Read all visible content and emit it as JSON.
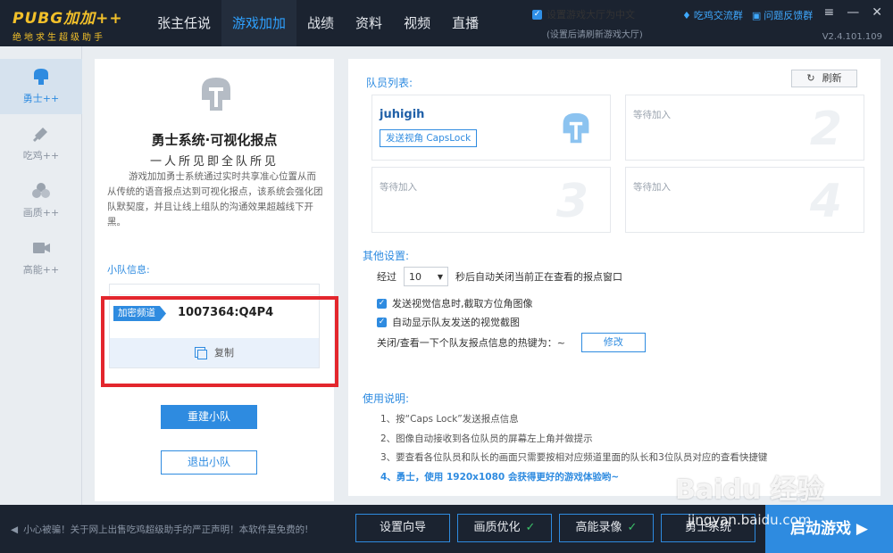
{
  "logo": {
    "title": "PUBG加加++",
    "subtitle": "绝地求生超级助手"
  },
  "nav": [
    {
      "label": "张主任说"
    },
    {
      "label": "游戏加加"
    },
    {
      "label": "战绩"
    },
    {
      "label": "资料"
    },
    {
      "label": "视频"
    },
    {
      "label": "直播"
    }
  ],
  "lang": {
    "label": "设置游戏大厅为中文",
    "hint": "(设置后请刷新游戏大厅)"
  },
  "links": {
    "group": "吃鸡交流群",
    "feedback": "问题反馈群"
  },
  "version": "V2.4.101.109",
  "sidebar": [
    {
      "label": "勇士++",
      "icon": "helmet-icon"
    },
    {
      "label": "吃鸡++",
      "icon": "chicken-icon"
    },
    {
      "label": "画质++",
      "icon": "quality-icon"
    },
    {
      "label": "高能++",
      "icon": "camera-icon"
    }
  ],
  "left": {
    "title": "勇士系统·可视化报点",
    "subtitle": "一人所见即全队所见",
    "desc": "游戏加加勇士系统通过实时共享准心位置从而从传统的语音报点达到可视化报点，该系统会强化团队默契度，并且让线上组队的沟通效果超越线下开黑。",
    "team_label": "小队信息:",
    "channel_tag": "加密频道",
    "channel_code": "1007364:Q4P4",
    "copy": "复制",
    "rebuild": "重建小队",
    "exit": "退出小队"
  },
  "right": {
    "members_label": "队员列表:",
    "refresh": "刷新",
    "members": [
      {
        "name": "juhigih",
        "send": "发送视角 CapsLock"
      },
      {
        "wait": "等待加入",
        "num": "2"
      },
      {
        "wait": "等待加入",
        "num": "3"
      },
      {
        "wait": "等待加入",
        "num": "4"
      }
    ],
    "other_label": "其他设置:",
    "after": "经过",
    "seconds_value": "10",
    "seconds_text": "秒后自动关闭当前正在查看的报点窗口",
    "opt1": "发送视觉信息时,截取方位角图像",
    "opt2": "自动显示队友发送的视觉截图",
    "hotkey_text": "关闭/查看一下个队友报点信息的热键为：~",
    "modify": "修改",
    "usage_label": "使用说明:",
    "usage": [
      "1、按“Caps Lock”发送报点信息",
      "2、图像自动接收到各位队员的屏幕左上角并做提示",
      "3、要查看各位队员和队长的画面只需要按相对应频道里面的队长和3位队员对应的查看快捷键",
      "4、勇士，使用 1920x1080 会获得更好的游戏体验哟~"
    ]
  },
  "bottom": {
    "notice": "小心被骗！关于网上出售吃鸡超级助手的严正声明！本软件是免费的!",
    "setup": "设置向导",
    "quality": "画质优化",
    "record": "高能录像",
    "other": "勇士系统",
    "start": "启动游戏"
  },
  "watermark": {
    "main": "Baidu 经验",
    "sub": "jingyan.baidu.com"
  }
}
